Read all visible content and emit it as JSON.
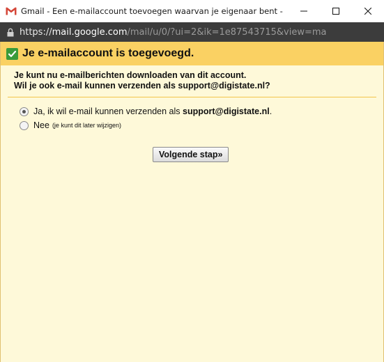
{
  "window": {
    "title": "Gmail - Een e-mailaccount toevoegen waarvan je eigenaar bent - Goo...",
    "app_icon": "gmail-icon",
    "controls": [
      "minimize-icon",
      "maximize-icon",
      "close-icon"
    ]
  },
  "address_bar": {
    "scheme": "https://",
    "host": "mail.google.com",
    "path": "/mail/u/0/?ui=2&ik=1e87543715&view=ma",
    "lock_icon": "lock-icon"
  },
  "dialog": {
    "header_icon": "checkmark-icon",
    "header_title": "Je e-mailaccount is toegevoegd.",
    "intro_line1": "Je kunt nu e-mailberichten downloaden van dit account.",
    "intro_line2": "Wil je ook e-mail kunnen verzenden als support@digistate.nl?",
    "options": {
      "yes_label_prefix": "Ja, ik wil e-mail kunnen verzenden als ",
      "yes_email": "support@digistate.nl",
      "yes_label_suffix": ".",
      "yes_selected": true,
      "no_label": "Nee",
      "no_note": "(je kunt dit later wijzigen)",
      "no_selected": false
    },
    "next_button": "Volgende stap»"
  },
  "colors": {
    "header_bg": "#fad163",
    "content_bg": "#fef9d9",
    "check_bg": "#3a9b3a",
    "addressbar_bg": "#3c3c3c"
  }
}
